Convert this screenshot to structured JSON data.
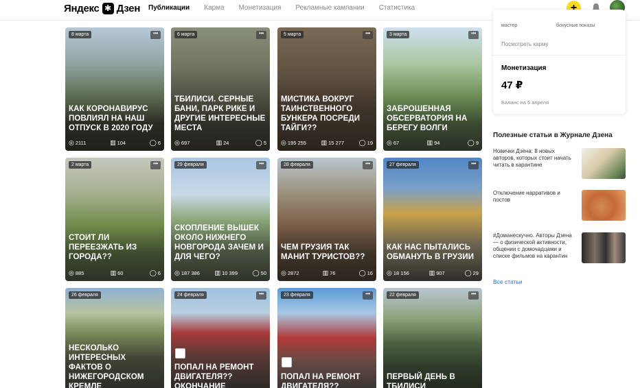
{
  "header": {
    "logo_text": "Яндекс",
    "logo_star": "✱",
    "logo_suffix": "Дзен",
    "nav": [
      "Публикации",
      "Карма",
      "Монетизация",
      "Рекламные кампании",
      "Статистика"
    ],
    "active_nav": "Публикации",
    "plus_label": "+"
  },
  "cards": [
    {
      "date": "8 марта",
      "title": "Как коронавирус повлиял на наш отпуск в 2020 году",
      "views": "2111",
      "reads": "104",
      "comments": "6"
    },
    {
      "date": "6 марта",
      "title": "Тбилиси. Серные бани, парк Рике и другие интересные места",
      "views": "697",
      "reads": "24",
      "comments": "5"
    },
    {
      "date": "5 марта",
      "title": "Мистика вокруг таинственного бункера посреди тайги??",
      "views": "195 255",
      "reads": "15 277",
      "comments": "19"
    },
    {
      "date": "3 марта",
      "title": "Заброшенная обсерватория на берегу Волги",
      "views": "67",
      "reads": "94",
      "comments": "9"
    },
    {
      "date": "2 марта",
      "title": "Стоит ли переезжать из города??",
      "views": "885",
      "reads": "60",
      "comments": "6"
    },
    {
      "date": "29 февраля",
      "title": "Скопление вышек около Нижнего Новгорода зачем и для чего?",
      "views": "187 386",
      "reads": "10 399",
      "comments": "50"
    },
    {
      "date": "28 февраля",
      "title": "Чем Грузия так манит туристов??",
      "views": "2872",
      "reads": "76",
      "comments": "16"
    },
    {
      "date": "27 февраля",
      "title": "Как нас пытались обмануть в Грузии",
      "views": "18 156",
      "reads": "907",
      "comments": "29"
    },
    {
      "date": "26 февраля",
      "title": "Несколько интересных фактов о Нижегородском кремле",
      "views": "",
      "reads": "",
      "comments": ""
    },
    {
      "date": "24 февраля",
      "title": "Попал на ремонт двигателя?? Окончание",
      "views": "",
      "reads": "",
      "comments": ""
    },
    {
      "date": "23 февраля",
      "title": "Попал на ремонт двигателя??",
      "views": "",
      "reads": "",
      "comments": ""
    },
    {
      "date": "22 февраля",
      "title": "Первый день в Тбилиси",
      "views": "",
      "reads": "",
      "comments": ""
    }
  ],
  "side": {
    "col1_label": "мастер",
    "col2_label": "бонусные показы",
    "karma_link": "Посмотреть карму",
    "monetization_title": "Монетизация",
    "monetization_value": "47 ₽",
    "balance_note": "Баланс на 5 апреля"
  },
  "journal": {
    "title": "Полезные статьи в Журнале Дзена",
    "items": [
      "Новички Дзена: 8 новых авторов, которых стоит начать читать в карантине",
      "Отключение нарративов и постов",
      "#Доманескучно. Авторы Дзена — о физической активности, общении с домочадцами и списке фильмов на карантин"
    ],
    "all_link": "Все статьи"
  },
  "colors": {
    "accent_yellow": "#ffdb1e",
    "link_blue": "#2c6fd6"
  }
}
